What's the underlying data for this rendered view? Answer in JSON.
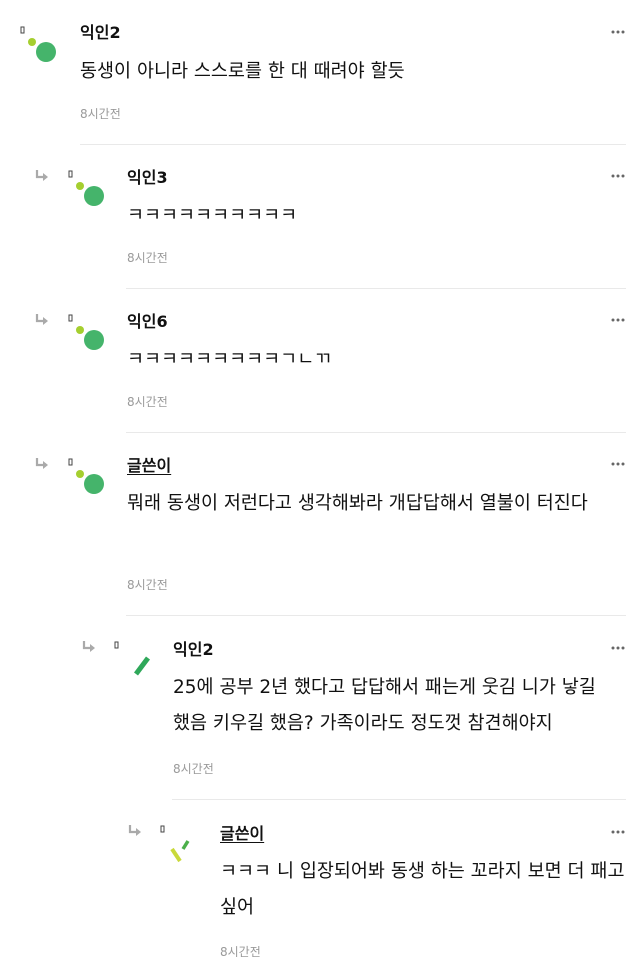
{
  "comments": [
    {
      "author": "익인2",
      "is_writer": false,
      "text": "동생이 아니라 스스로를 한 대 때려야 할듯",
      "time": "8시간전",
      "depth": 0,
      "avatar": "green-dots"
    },
    {
      "author": "익인3",
      "is_writer": false,
      "text": "ㅋㅋㅋㅋㅋㅋㅋㅋㅋㅋ",
      "time": "8시간전",
      "depth": 1,
      "avatar": "green-dots"
    },
    {
      "author": "익인6",
      "is_writer": false,
      "text": "ㅋㅋㅋㅋㅋㅋㅋㅋㅋㄱㄴㄲ",
      "time": "8시간전",
      "depth": 1,
      "avatar": "green-dots"
    },
    {
      "author": "글쓴이",
      "is_writer": true,
      "text": "뭐래 동생이 저런다고 생각해봐라 개답답해서 열불이 터진다",
      "time": "8시간전",
      "depth": 1,
      "avatar": "green-dots"
    },
    {
      "author": "익인2",
      "is_writer": false,
      "text": "25에 공부 2년 했다고 답답해서 패는게 웃김 니가 낳길 했음 키우길 했음? 가족이라도 정도껏 참견해야지",
      "time": "8시간전",
      "depth": 2,
      "avatar": "green-dash"
    },
    {
      "author": "글쓴이",
      "is_writer": true,
      "text": "ㅋㅋㅋ 니 입장되어봐 동생 하는 꼬라지 보면 더 패고 싶어",
      "time": "8시간전",
      "depth": 3,
      "avatar": "lime-dash"
    }
  ],
  "icons": {
    "more": "more-dots-icon",
    "reply": "reply-arrow-icon"
  },
  "colors": {
    "avatar_green": "#45b46b",
    "avatar_lime": "#a5cf2f",
    "divider": "#e9e9e9",
    "time": "#9a9a9a"
  }
}
